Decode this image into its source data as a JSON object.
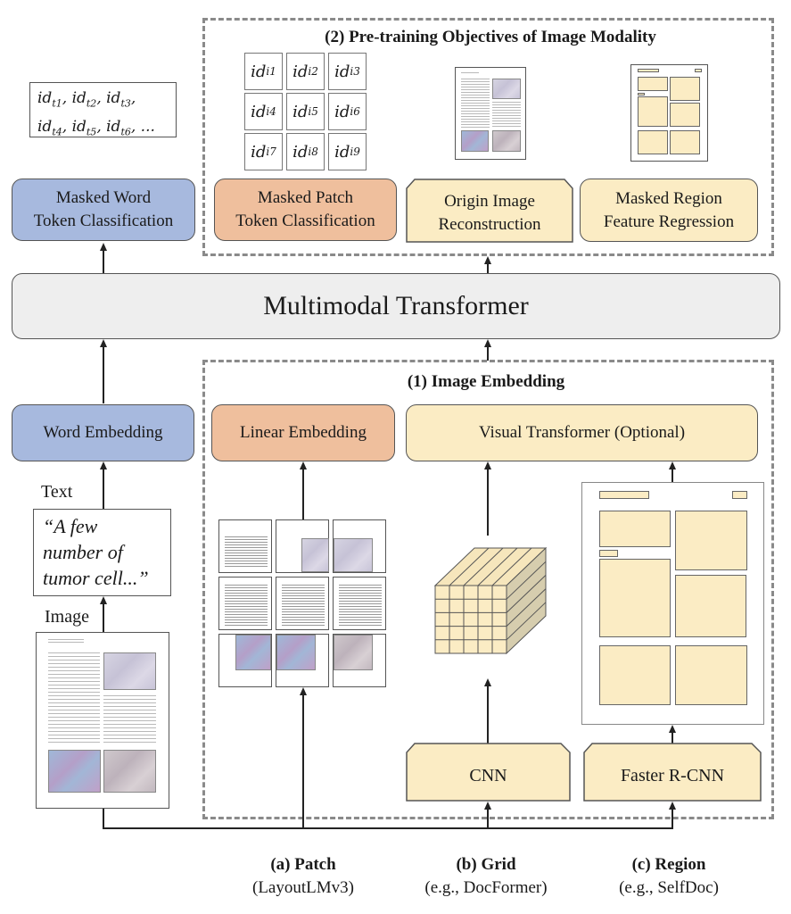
{
  "pretraining": {
    "title": "(2) Pre-training Objectives of Image Modality",
    "word_token_ids": [
      "id_t1, id_t2, id_t3,",
      "id_t4, id_t5, id_t6, ..."
    ],
    "patch_token_ids": [
      {
        "base": "id",
        "sub": "i1"
      },
      {
        "base": "id",
        "sub": "i2"
      },
      {
        "base": "id",
        "sub": "i3"
      },
      {
        "base": "id",
        "sub": "i4"
      },
      {
        "base": "id",
        "sub": "i5"
      },
      {
        "base": "id",
        "sub": "i6"
      },
      {
        "base": "id",
        "sub": "i7"
      },
      {
        "base": "id",
        "sub": "i8"
      },
      {
        "base": "id",
        "sub": "i9"
      }
    ],
    "word_ids_line1": [
      {
        "base": "id",
        "sub": "t1"
      },
      {
        "base": "id",
        "sub": "t2"
      },
      {
        "base": "id",
        "sub": "t3"
      }
    ],
    "word_ids_line2": [
      {
        "base": "id",
        "sub": "t4"
      },
      {
        "base": "id",
        "sub": "t5"
      },
      {
        "base": "id",
        "sub": "t6"
      }
    ],
    "objectives": {
      "masked_word": {
        "line1": "Masked Word",
        "line2": "Token Classification"
      },
      "masked_patch": {
        "line1": "Masked Patch",
        "line2": "Token Classification"
      },
      "origin_image": {
        "line1": "Origin Image",
        "line2": "Reconstruction"
      },
      "masked_region": {
        "line1": "Masked Region",
        "line2": "Feature Regression"
      }
    }
  },
  "transformer": {
    "label": "Multimodal Transformer"
  },
  "embedding": {
    "title": "(1) Image Embedding",
    "word_embedding": "Word Embedding",
    "linear_embedding": "Linear Embedding",
    "visual_transformer": "Visual Transformer (Optional)",
    "cnn": "CNN",
    "faster_rcnn": "Faster R-CNN"
  },
  "inputs": {
    "text_label": "Text",
    "text_sample": [
      "“A few",
      "number of",
      "tumor cell...”"
    ],
    "image_label": "Image"
  },
  "captions": [
    {
      "title": "(a) Patch",
      "subtitle": "(LayoutLMv3)"
    },
    {
      "title": "(b) Grid",
      "subtitle": "(e.g., DocFormer)"
    },
    {
      "title": "(c) Region",
      "subtitle": "(e.g., SelfDoc)"
    }
  ],
  "colors": {
    "text_modality": "#a7b9de",
    "patch": "#efbf9d",
    "image_feature": "#fbecc4",
    "transformer": "#eeeeee",
    "dashed_border": "#8a8a8a"
  }
}
